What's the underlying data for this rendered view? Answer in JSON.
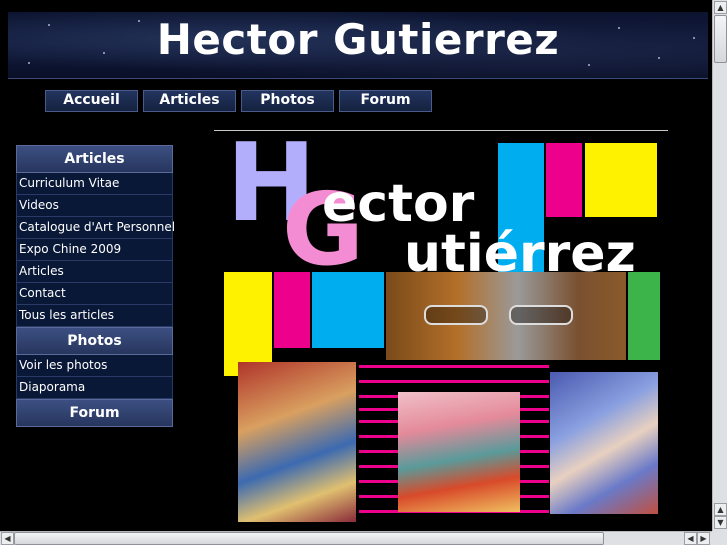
{
  "header": {
    "title": "Hector Gutierrez"
  },
  "topnav": [
    {
      "label": "Accueil"
    },
    {
      "label": "Articles"
    },
    {
      "label": "Photos"
    },
    {
      "label": "Forum"
    }
  ],
  "sidebar": {
    "sections": [
      {
        "title": "Articles",
        "items": [
          {
            "label": "Curriculum Vitae"
          },
          {
            "label": "Videos"
          },
          {
            "label": "Catalogue d'Art Personnel"
          },
          {
            "label": "Expo Chine 2009"
          },
          {
            "label": "Articles"
          },
          {
            "label": "Contact"
          },
          {
            "label": "Tous les articles"
          }
        ]
      },
      {
        "title": "Photos",
        "items": [
          {
            "label": "Voir les photos"
          },
          {
            "label": "Diaporama"
          }
        ]
      },
      {
        "title": "Forum",
        "items": []
      }
    ]
  },
  "banner": {
    "letter_h": "H",
    "letter_g": "G",
    "line1": "ector",
    "line2": "utiérrez",
    "colors": {
      "lavender": "#b3aefc",
      "pink": "#f48cd4",
      "cyan": "#00adef",
      "magenta": "#ec008c",
      "yellow": "#fff200",
      "green": "#3cb44a"
    }
  },
  "icons": {
    "scroll_up": "arrow-up-icon",
    "scroll_down": "arrow-down-icon",
    "scroll_left": "arrow-left-icon",
    "scroll_right": "arrow-right-icon"
  }
}
